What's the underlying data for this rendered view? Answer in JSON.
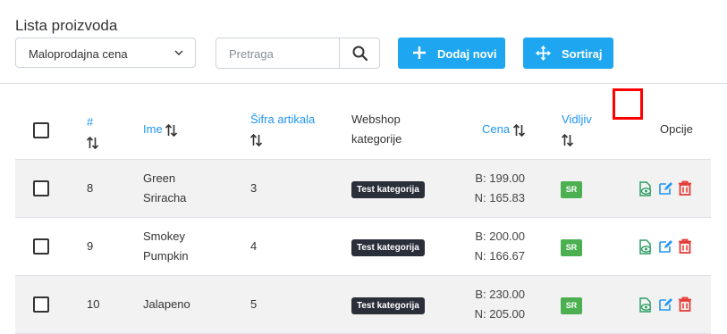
{
  "header": {
    "title": "Lista proizvoda",
    "price_select": {
      "value": "Maloprodajna cena"
    },
    "search": {
      "placeholder": "Pretraga"
    },
    "add_button_label": "Dodaj novi",
    "sort_button_label": "Sortiraj"
  },
  "table": {
    "columns": {
      "id": "#",
      "name": "Ime",
      "sku": "Šifra artikala",
      "webshop": "Webshop kategorije",
      "price": "Cena",
      "visible": "Vidljiv",
      "options": "Opcije"
    },
    "rows": [
      {
        "id": "8",
        "name_line1": "Green",
        "name_line2": "Sriracha",
        "sku": "3",
        "category": "Test kategorija",
        "price_b": "B: 199.00",
        "price_n": "N: 165.83",
        "visible": "SR"
      },
      {
        "id": "9",
        "name_line1": "Smokey",
        "name_line2": "Pumpkin",
        "sku": "4",
        "category": "Test kategorija",
        "price_b": "B: 200.00",
        "price_n": "N: 166.67",
        "visible": "SR"
      },
      {
        "id": "10",
        "name_line1": "Jalapeno",
        "name_line2": "",
        "sku": "5",
        "category": "Test kategorija",
        "price_b": "B: 230.00",
        "price_n": "N: 205.00",
        "visible": "SR"
      }
    ]
  },
  "colors": {
    "primary": "#1ea7f0",
    "link": "#2196f3",
    "badge_dark": "#2b2f3a",
    "visible_green": "#4caf50",
    "delete_red": "#e53935",
    "view_green": "#2e9e63",
    "highlight": "#ff0000"
  },
  "icons": [
    "chevron-down-icon",
    "search-icon",
    "plus-icon",
    "move-icon",
    "sort-arrows-icon",
    "view-icon",
    "edit-icon",
    "trash-icon"
  ]
}
